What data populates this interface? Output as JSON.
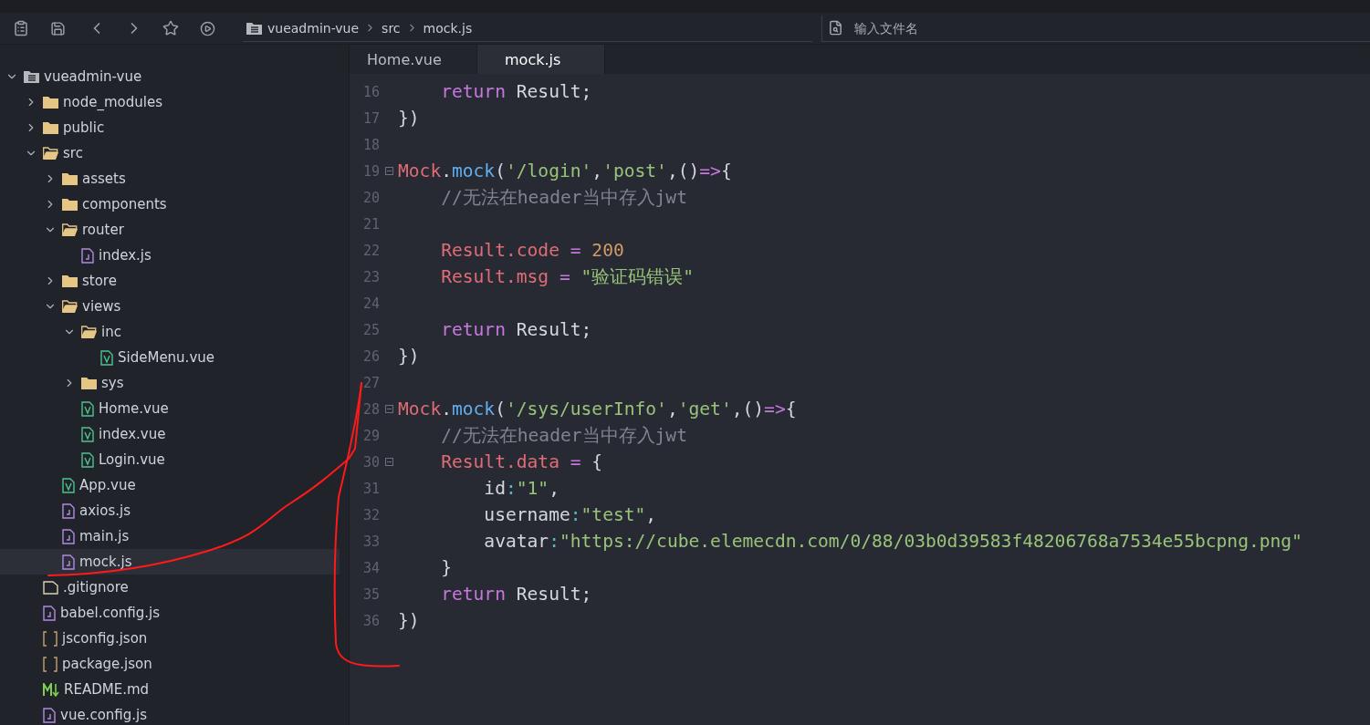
{
  "toolbar": {
    "breadcrumb": [
      "vueadmin-vue",
      "src",
      "mock.js"
    ],
    "search": {
      "placeholder": "输入文件名"
    }
  },
  "tree": [
    {
      "name": "vueadmin-vue",
      "kind": "project",
      "expanded": true,
      "selected": false,
      "children": [
        {
          "name": "node_modules",
          "kind": "folder",
          "expanded": false,
          "selected": false
        },
        {
          "name": "public",
          "kind": "folder",
          "expanded": false,
          "selected": false
        },
        {
          "name": "src",
          "kind": "folder",
          "expanded": true,
          "selected": false,
          "children": [
            {
              "name": "assets",
              "kind": "folder",
              "expanded": false,
              "selected": false
            },
            {
              "name": "components",
              "kind": "folder",
              "expanded": false,
              "selected": false
            },
            {
              "name": "router",
              "kind": "folder",
              "expanded": true,
              "selected": false,
              "children": [
                {
                  "name": "index.js",
                  "kind": "js",
                  "selected": false
                }
              ]
            },
            {
              "name": "store",
              "kind": "folder",
              "expanded": false,
              "selected": false
            },
            {
              "name": "views",
              "kind": "folder",
              "expanded": true,
              "selected": false,
              "children": [
                {
                  "name": "inc",
                  "kind": "folder",
                  "expanded": true,
                  "selected": false,
                  "children": [
                    {
                      "name": "SideMenu.vue",
                      "kind": "vue",
                      "selected": false
                    }
                  ]
                },
                {
                  "name": "sys",
                  "kind": "folder",
                  "expanded": false,
                  "selected": false
                },
                {
                  "name": "Home.vue",
                  "kind": "vue",
                  "selected": false
                },
                {
                  "name": "index.vue",
                  "kind": "vue",
                  "selected": false
                },
                {
                  "name": "Login.vue",
                  "kind": "vue",
                  "selected": false
                }
              ]
            },
            {
              "name": "App.vue",
              "kind": "vue",
              "selected": false
            },
            {
              "name": "axios.js",
              "kind": "js",
              "selected": false
            },
            {
              "name": "main.js",
              "kind": "js",
              "selected": false
            },
            {
              "name": "mock.js",
              "kind": "js",
              "selected": true
            }
          ]
        },
        {
          "name": ".gitignore",
          "kind": "file",
          "selected": false
        },
        {
          "name": "babel.config.js",
          "kind": "js",
          "selected": false
        },
        {
          "name": "jsconfig.json",
          "kind": "json",
          "selected": false
        },
        {
          "name": "package.json",
          "kind": "json",
          "selected": false
        },
        {
          "name": "README.md",
          "kind": "md",
          "selected": false
        },
        {
          "name": "vue.config.js",
          "kind": "js",
          "selected": false
        }
      ]
    }
  ],
  "tabs": [
    {
      "label": "Home.vue",
      "selected": false
    },
    {
      "label": "mock.js",
      "selected": true
    }
  ],
  "code": [
    {
      "number": "16",
      "fold": false,
      "tokens": [
        {
          "kind": "keyword",
          "text": "    return"
        },
        {
          "kind": "plain",
          "text": " Result;"
        }
      ]
    },
    {
      "number": "17",
      "fold": false,
      "tokens": [
        {
          "kind": "plain",
          "text": "})"
        }
      ]
    },
    {
      "number": "18",
      "fold": false
    },
    {
      "number": "19",
      "fold": true,
      "tokens": [
        {
          "kind": "object",
          "text": "Mock"
        },
        {
          "kind": "plain",
          "text": "."
        },
        {
          "kind": "function",
          "text": "mock"
        },
        {
          "kind": "plain",
          "text": "("
        },
        {
          "kind": "string",
          "text": "'/login'"
        },
        {
          "kind": "plain",
          "text": ","
        },
        {
          "kind": "string",
          "text": "'post'"
        },
        {
          "kind": "plain",
          "text": ",()"
        },
        {
          "kind": "operator",
          "text": "=>"
        },
        {
          "kind": "plain",
          "text": "{"
        }
      ]
    },
    {
      "number": "20",
      "fold": false,
      "tokens": [
        {
          "kind": "comment",
          "text": "    //无法在header当中存入jwt"
        }
      ]
    },
    {
      "number": "21",
      "fold": false
    },
    {
      "number": "22",
      "fold": false,
      "tokens": [
        {
          "kind": "object",
          "text": "    Result.code"
        },
        {
          "kind": "operator",
          "text": " = "
        },
        {
          "kind": "number",
          "text": "200"
        }
      ]
    },
    {
      "number": "23",
      "fold": false,
      "tokens": [
        {
          "kind": "object",
          "text": "    Result.msg"
        },
        {
          "kind": "operator",
          "text": " = "
        },
        {
          "kind": "string",
          "text": "\"验证码错误\""
        }
      ]
    },
    {
      "number": "24",
      "fold": false
    },
    {
      "number": "25",
      "fold": false,
      "tokens": [
        {
          "kind": "keyword",
          "text": "    return"
        },
        {
          "kind": "plain",
          "text": " Result;"
        }
      ]
    },
    {
      "number": "26",
      "fold": false,
      "tokens": [
        {
          "kind": "plain",
          "text": "})"
        }
      ]
    },
    {
      "number": "27",
      "fold": false
    },
    {
      "number": "28",
      "fold": true,
      "tokens": [
        {
          "kind": "object",
          "text": "Mock"
        },
        {
          "kind": "plain",
          "text": "."
        },
        {
          "kind": "function",
          "text": "mock"
        },
        {
          "kind": "plain",
          "text": "("
        },
        {
          "kind": "string",
          "text": "'/sys/userInfo'"
        },
        {
          "kind": "plain",
          "text": ","
        },
        {
          "kind": "string",
          "text": "'get'"
        },
        {
          "kind": "plain",
          "text": ",()"
        },
        {
          "kind": "operator",
          "text": "=>"
        },
        {
          "kind": "plain",
          "text": "{"
        }
      ]
    },
    {
      "number": "29",
      "fold": false,
      "tokens": [
        {
          "kind": "comment",
          "text": "    //无法在header当中存入jwt"
        }
      ]
    },
    {
      "number": "30",
      "fold": true,
      "tokens": [
        {
          "kind": "object",
          "text": "    Result.data"
        },
        {
          "kind": "operator",
          "text": " = "
        },
        {
          "kind": "plain",
          "text": "{"
        }
      ]
    },
    {
      "number": "31",
      "fold": false,
      "tokens": [
        {
          "kind": "plain",
          "text": "        id"
        },
        {
          "kind": "punct",
          "text": ":"
        },
        {
          "kind": "string",
          "text": "\"1\""
        },
        {
          "kind": "plain",
          "text": ","
        }
      ]
    },
    {
      "number": "32",
      "fold": false,
      "tokens": [
        {
          "kind": "plain",
          "text": "        username"
        },
        {
          "kind": "punct",
          "text": ":"
        },
        {
          "kind": "string",
          "text": "\"test\""
        },
        {
          "kind": "plain",
          "text": ","
        }
      ]
    },
    {
      "number": "33",
      "fold": false,
      "tokens": [
        {
          "kind": "plain",
          "text": "        avatar"
        },
        {
          "kind": "punct",
          "text": ":"
        },
        {
          "kind": "string",
          "text": "\"https://cube.elemecdn.com/0/88/03b0d39583f48206768a7534e55bcpng.png\""
        }
      ]
    },
    {
      "number": "34",
      "fold": false,
      "tokens": [
        {
          "kind": "plain",
          "text": "    }"
        }
      ]
    },
    {
      "number": "35",
      "fold": false,
      "tokens": [
        {
          "kind": "keyword",
          "text": "    return"
        },
        {
          "kind": "plain",
          "text": " Result;"
        }
      ]
    },
    {
      "number": "36",
      "fold": false,
      "tokens": [
        {
          "kind": "plain",
          "text": "})"
        }
      ]
    }
  ]
}
